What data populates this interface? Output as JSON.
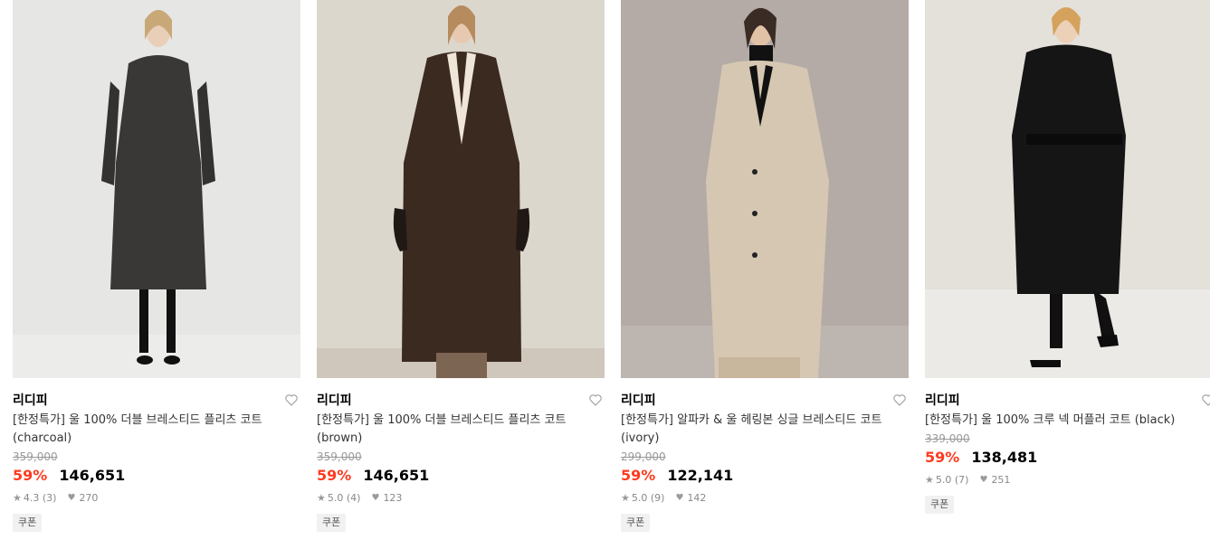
{
  "products": [
    {
      "brand": "리디피",
      "name": "[한정특가] 울 100% 더블 브레스티드 플리츠 코트 (charcoal)",
      "original_price": "359,000",
      "discount": "59%",
      "price": "146,651",
      "rating": "4.3",
      "review_count": "(3)",
      "likes": "270",
      "badge": "쿠폰",
      "image_alt": "model-in-charcoal-double-breasted-coat",
      "coat_color": "#3a3836"
    },
    {
      "brand": "리디피",
      "name": "[한정특가] 울 100% 더블 브레스티드 플리츠 코트 (brown)",
      "original_price": "359,000",
      "discount": "59%",
      "price": "146,651",
      "rating": "5.0",
      "review_count": "(4)",
      "likes": "123",
      "badge": "쿠폰",
      "image_alt": "model-in-brown-double-breasted-coat",
      "coat_color": "#3b2a20"
    },
    {
      "brand": "리디피",
      "name": "[한정특가] 알파카 & 울 헤링본 싱글 브레스티드 코트 (ivory)",
      "original_price": "299,000",
      "discount": "59%",
      "price": "122,141",
      "rating": "5.0",
      "review_count": "(9)",
      "likes": "142",
      "badge": "쿠폰",
      "image_alt": "model-in-ivory-single-breasted-coat",
      "coat_color": "#d6c7b2"
    },
    {
      "brand": "리디피",
      "name": "[한정특가] 울 100% 크루 넥 머플러 코트 (black)",
      "original_price": "339,000",
      "discount": "59%",
      "price": "138,481",
      "rating": "5.0",
      "review_count": "(7)",
      "likes": "251",
      "badge": "쿠폰",
      "image_alt": "model-in-black-muffler-coat",
      "coat_color": "#151515"
    }
  ],
  "colors": {
    "discount": "#ff3b1f",
    "bg1": "#e4e4e2",
    "bg2": "#dad5cc",
    "bg3": "#b3aaa5",
    "bg4": "#e3dfd9"
  }
}
